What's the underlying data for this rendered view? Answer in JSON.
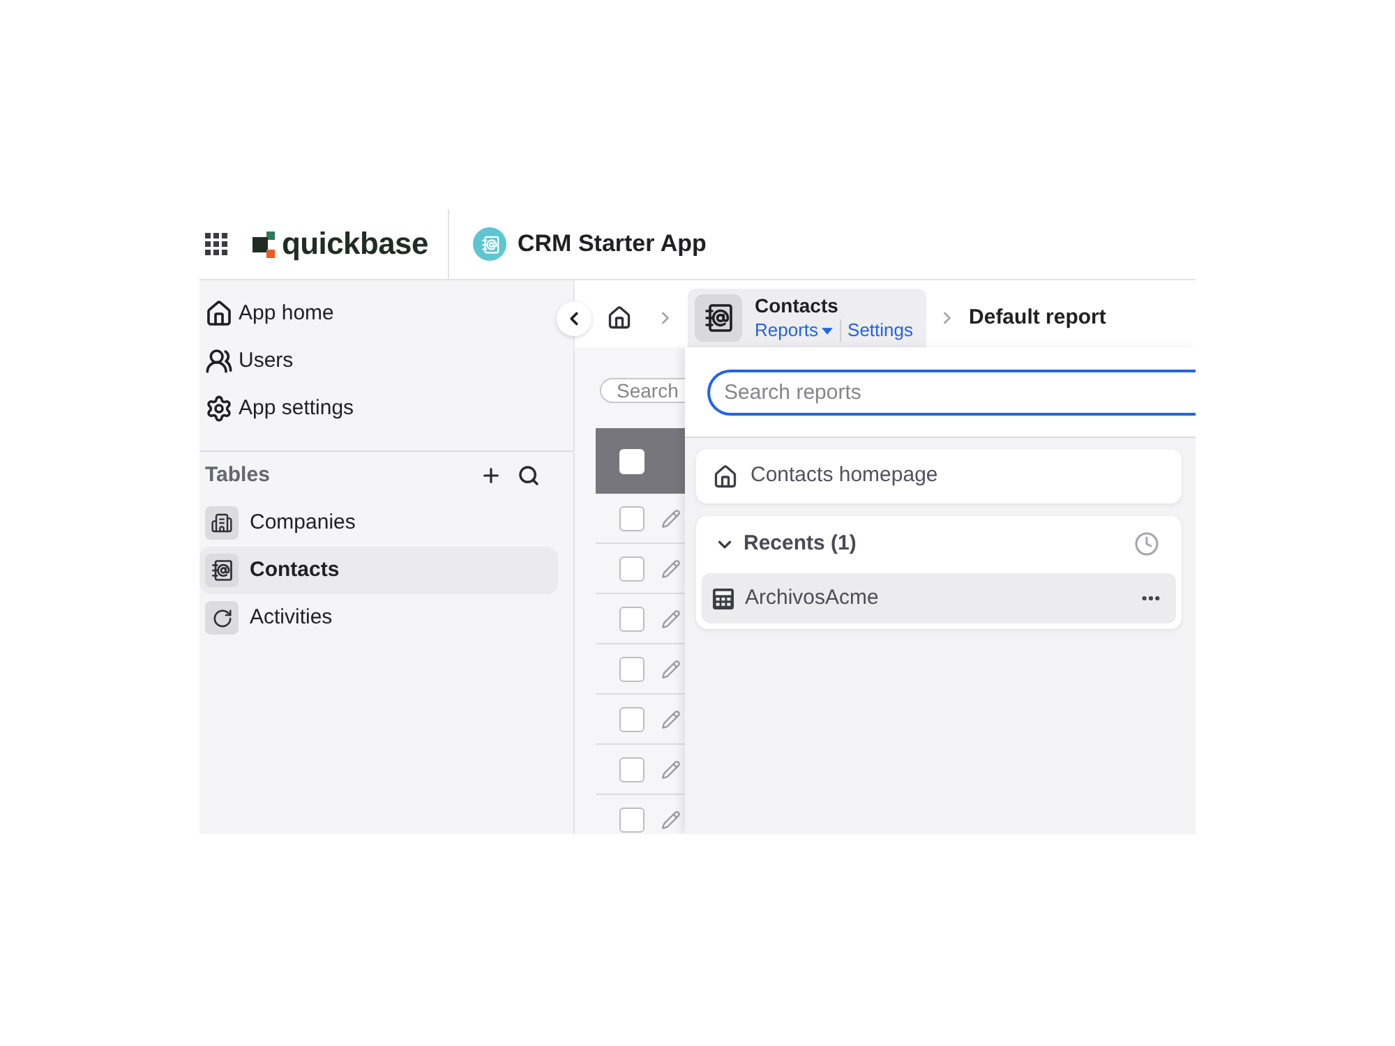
{
  "header": {
    "logo_text": "quickbase",
    "app_name": "CRM Starter App"
  },
  "sidebar": {
    "nav_items": [
      {
        "label": "App home",
        "kind": "home"
      },
      {
        "label": "Users",
        "kind": "users"
      },
      {
        "label": "App settings",
        "kind": "settings"
      }
    ],
    "tables_heading": "Tables",
    "tables": [
      {
        "label": "Companies",
        "kind": "companies",
        "selected": false
      },
      {
        "label": "Contacts",
        "kind": "contacts",
        "selected": true
      },
      {
        "label": "Activities",
        "kind": "activities",
        "selected": false
      }
    ]
  },
  "breadcrumb": {
    "table_name": "Contacts",
    "links": [
      {
        "label": "Reports",
        "kind": "menu"
      },
      {
        "label": "Settings",
        "kind": "link"
      }
    ],
    "current": "Default report"
  },
  "report_view": {
    "search": {
      "placeholder": "Search"
    },
    "select_all": {
      "checked": false
    },
    "rows": [
      {
        "checked": false
      },
      {
        "checked": false
      },
      {
        "checked": false
      },
      {
        "checked": false
      },
      {
        "checked": false
      },
      {
        "checked": false
      },
      {
        "checked": false
      }
    ]
  },
  "reports_menu": {
    "search": {
      "placeholder": "Search reports",
      "focused": true
    },
    "homepage_link": "Contacts homepage",
    "recents": {
      "title": "Recents (1)",
      "expanded": true,
      "items": [
        {
          "label": "ArchivosAcme",
          "highlighted": true
        }
      ]
    }
  }
}
